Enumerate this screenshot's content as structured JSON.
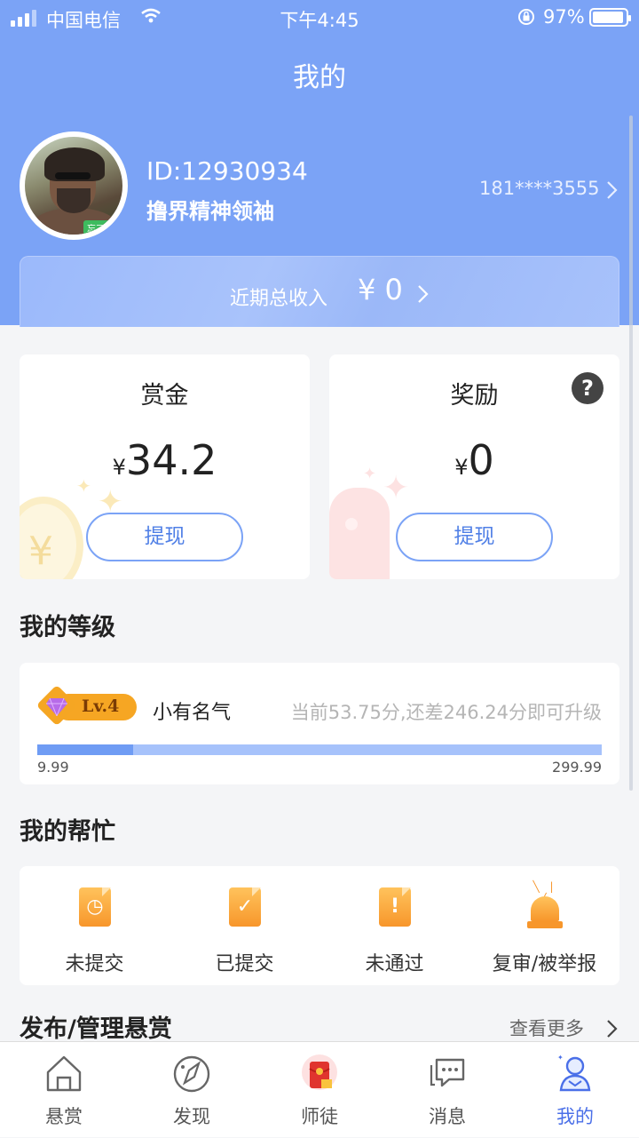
{
  "status_bar": {
    "carrier": "中国电信",
    "time": "下午4:45",
    "battery": "97%"
  },
  "nav": {
    "title": "我的"
  },
  "profile": {
    "user_id": "ID:12930934",
    "name": "撸界精神领袖",
    "phone": "181****3555",
    "avatar_tag": "忘了我"
  },
  "income": {
    "label": "近期总收入",
    "amount": "¥ 0"
  },
  "cards": {
    "bounty": {
      "title": "赏金",
      "currency": "¥",
      "value": "34.2",
      "button": "提现"
    },
    "reward": {
      "title": "奖励",
      "currency": "¥",
      "value": "0",
      "button": "提现",
      "help_icon": "?"
    }
  },
  "level": {
    "section_title": "我的等级",
    "badge": "Lv.4",
    "name": "小有名气",
    "hint": "当前53.75分,还差246.24分即可升级",
    "min": "9.99",
    "max": "299.99",
    "progress_fraction": 0.17
  },
  "help": {
    "section_title": "我的帮忙",
    "items": [
      {
        "label": "未提交",
        "icon": "clock-doc-icon"
      },
      {
        "label": "已提交",
        "icon": "check-doc-icon"
      },
      {
        "label": "未通过",
        "icon": "warning-doc-icon"
      },
      {
        "label": "复审/被举报",
        "icon": "siren-icon"
      }
    ]
  },
  "publish": {
    "title": "发布/管理悬赏",
    "more": "查看更多"
  },
  "tabbar": {
    "items": [
      {
        "label": "悬赏",
        "icon": "home-icon"
      },
      {
        "label": "发现",
        "icon": "compass-icon"
      },
      {
        "label": "师徒",
        "icon": "red-packet-icon"
      },
      {
        "label": "消息",
        "icon": "message-icon"
      },
      {
        "label": "我的",
        "icon": "user-icon"
      }
    ],
    "active_index": 4
  },
  "colors": {
    "primary": "#7ba3f6",
    "accent": "#4a6fe8",
    "warning": "#f7962b"
  }
}
